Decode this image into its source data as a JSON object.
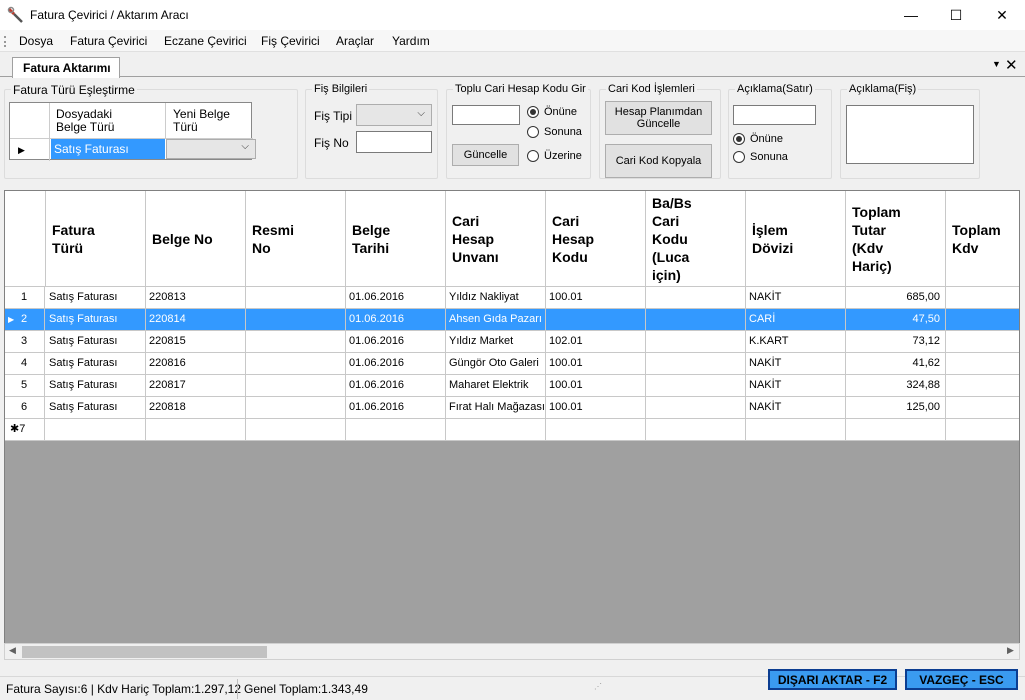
{
  "window": {
    "title": "Fatura Çevirici / Aktarım Aracı",
    "controls": {
      "minimize": "—",
      "maximize": "☐",
      "close": "✕"
    }
  },
  "menu": [
    "Dosya",
    "Fatura Çevirici",
    "Eczane Çevirici",
    "Fiş Çevirici",
    "Araçlar",
    "Yardım"
  ],
  "tab": {
    "label": "Fatura Aktarımı",
    "dropdown": "▼",
    "close": "✕"
  },
  "fatura_turu": {
    "title": "Fatura Türü Eşleştirme",
    "col1": "Dosyadaki\nBelge Türü",
    "col2": "Yeni Belge\nTürü",
    "row_marker": "▶",
    "row_value": "Satış Faturası",
    "dropdown_arrow": "⌵"
  },
  "fis_bilgileri": {
    "title": "Fiş Bilgileri",
    "fis_tipi_label": "Fiş Tipi",
    "fis_no_label": "Fiş No",
    "dropdown_arrow": "⌵"
  },
  "toplu_cari": {
    "title": "Toplu Cari Hesap Kodu Gir",
    "guncelle_button": "Güncelle",
    "radios": [
      {
        "label": "Önüne",
        "checked": true
      },
      {
        "label": "Sonuna",
        "checked": false
      },
      {
        "label": "Üzerine",
        "checked": false
      }
    ]
  },
  "cari_kod": {
    "title": "Cari Kod İşlemleri",
    "hesap_plani_button": "Hesap Planımdan\nGüncelle",
    "kopyala_button": "Cari Kod Kopyala"
  },
  "aciklama_satir": {
    "title": "Açıklama(Satır)",
    "radios": [
      {
        "label": "Önüne",
        "checked": true
      },
      {
        "label": "Sonuna",
        "checked": false
      }
    ]
  },
  "aciklama_fis": {
    "title": "Açıklama(Fiş)"
  },
  "grid": {
    "columns": [
      "Fatura\nTürü",
      "Belge No",
      "Resmi\nNo",
      "Belge\nTarihi",
      "Cari\nHesap\nUnvanı",
      "Cari\nHesap\nKodu",
      "Ba/Bs\nCari\nKodu\n(Luca\niçin)",
      "İşlem\nDövizi",
      "Toplam\nTutar\n(Kdv\nHariç)",
      "Toplam\nKdv"
    ],
    "rows": [
      {
        "no": "1",
        "tur": "Satış Faturası",
        "belge_no": "220813",
        "resmi_no": "",
        "tarih": "01.06.2016",
        "unvan": "Yıldız Nakliyat",
        "kod": "100.01",
        "babs": "",
        "doviz": "NAKİT",
        "tutar": "685,00",
        "kdv": "",
        "selected": false
      },
      {
        "no": "2",
        "tur": "Satış Faturası",
        "belge_no": "220814",
        "resmi_no": "",
        "tarih": "01.06.2016",
        "unvan": "Ahsen Gıda Pazarı",
        "kod": "",
        "babs": "",
        "doviz": "CARİ",
        "tutar": "47,50",
        "kdv": "",
        "selected": true
      },
      {
        "no": "3",
        "tur": "Satış Faturası",
        "belge_no": "220815",
        "resmi_no": "",
        "tarih": "01.06.2016",
        "unvan": "Yıldız Market",
        "kod": "102.01",
        "babs": "",
        "doviz": "K.KART",
        "tutar": "73,12",
        "kdv": "",
        "selected": false
      },
      {
        "no": "4",
        "tur": "Satış Faturası",
        "belge_no": "220816",
        "resmi_no": "",
        "tarih": "01.06.2016",
        "unvan": "Güngör Oto Galeri",
        "kod": "100.01",
        "babs": "",
        "doviz": "NAKİT",
        "tutar": "41,62",
        "kdv": "",
        "selected": false
      },
      {
        "no": "5",
        "tur": "Satış Faturası",
        "belge_no": "220817",
        "resmi_no": "",
        "tarih": "01.06.2016",
        "unvan": "Maharet Elektrik",
        "kod": "100.01",
        "babs": "",
        "doviz": "NAKİT",
        "tutar": "324,88",
        "kdv": "",
        "selected": false
      },
      {
        "no": "6",
        "tur": "Satış Faturası",
        "belge_no": "220818",
        "resmi_no": "",
        "tarih": "01.06.2016",
        "unvan": "Fırat Halı Mağazası",
        "kod": "100.01",
        "babs": "",
        "doviz": "NAKİT",
        "tutar": "125,00",
        "kdv": "",
        "selected": false
      }
    ],
    "new_row_label": "✱7",
    "selected_marker": "▶"
  },
  "status": {
    "summary": "Fatura Sayısı:6 | Kdv Hariç Toplam:1.297,12",
    "genel_toplam": "Genel Toplam:1.343,49"
  },
  "actions": {
    "export": "DIŞARI AKTAR - F2",
    "cancel": "VAZGEÇ - ESC"
  },
  "colors": {
    "selection": "#3399ff",
    "action_button": "#3a9bf0",
    "action_border": "#0b3d91"
  }
}
